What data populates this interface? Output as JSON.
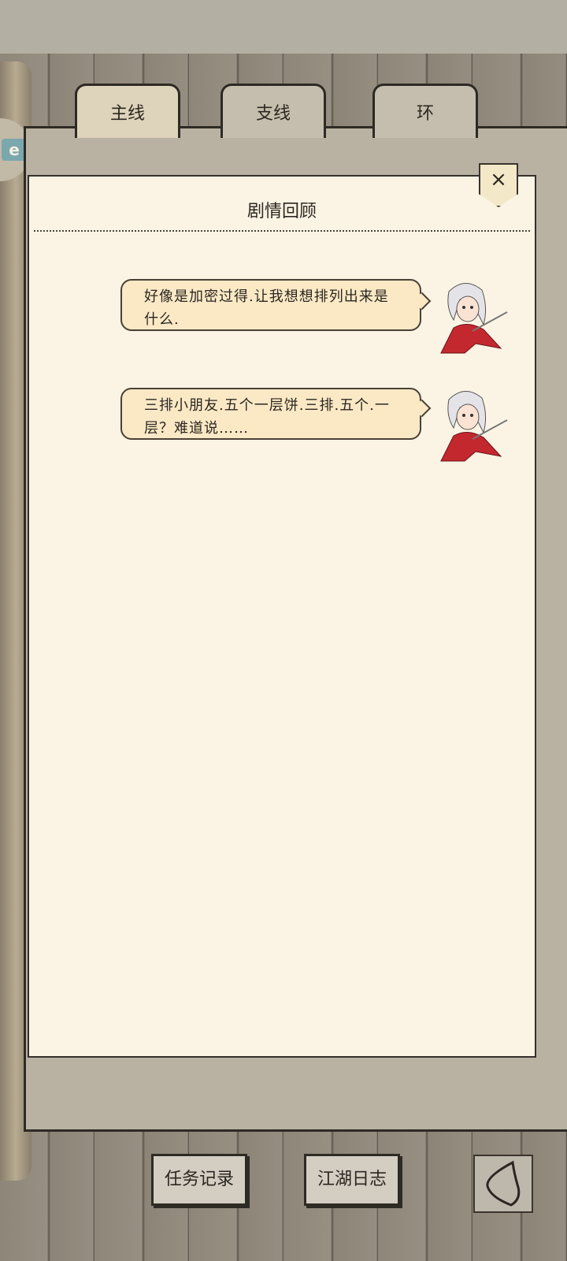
{
  "tabs": [
    {
      "label": "主线",
      "active": true
    },
    {
      "label": "支线",
      "active": false
    },
    {
      "label": "环",
      "active": false
    }
  ],
  "side_icon": "e",
  "panel": {
    "title": "剧情回顾",
    "close_icon": "×"
  },
  "dialogues": [
    {
      "line1": "好像是加密过得.让我想想排列出来是",
      "line2": "什么."
    },
    {
      "line1": "三排小朋友.五个一层饼.三排.五个.一",
      "line2": "层？难道说……"
    }
  ],
  "bottom": {
    "task_record": "任务记录",
    "jianghu_log": "江湖日志"
  },
  "colors": {
    "panel_bg": "#fbf4e4",
    "bubble_bg": "#fbe9c6",
    "border": "#2e2a24"
  }
}
